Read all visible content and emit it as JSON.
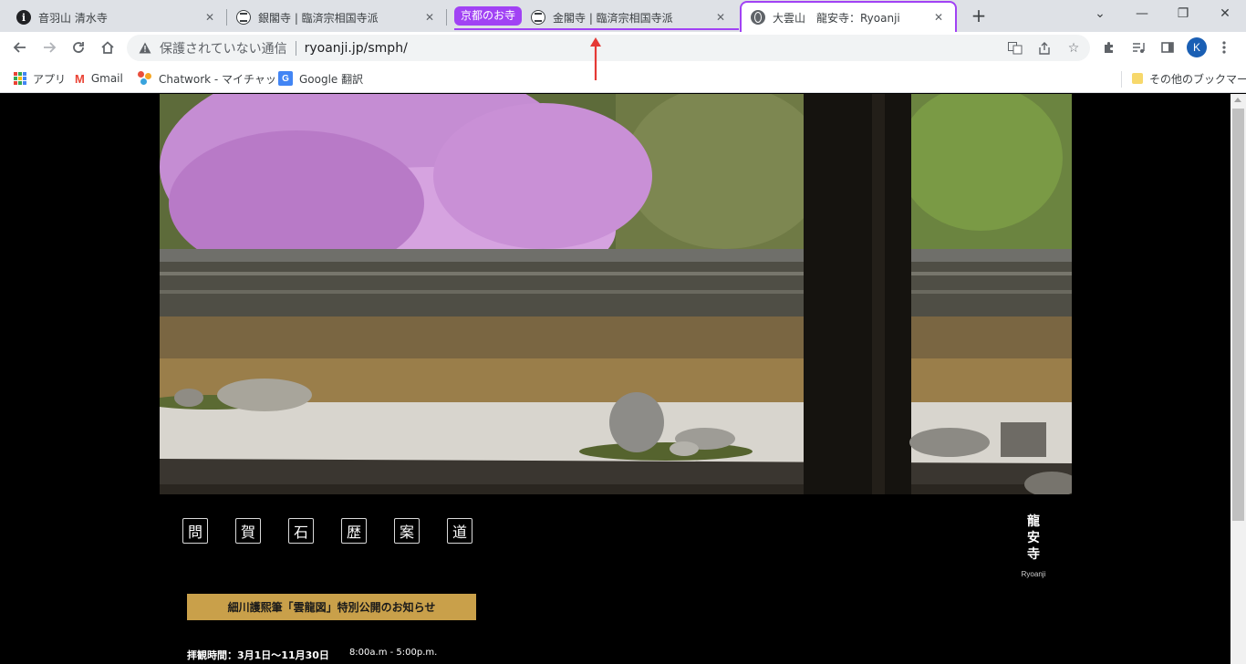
{
  "browser": {
    "tabs": [
      {
        "title": "音羽山 清水寺",
        "favicon": "info-icon"
      },
      {
        "title": "銀閣寺 | 臨済宗相国寺派",
        "favicon": "temple-icon"
      },
      {
        "title": "金閣寺 | 臨済宗相国寺派",
        "favicon": "temple-icon"
      },
      {
        "title": "大雲山　龍安寺：Ryoanji",
        "favicon": "globe-icon"
      }
    ],
    "active_tab_index": 3,
    "tab_group": {
      "label": "京都のお寺",
      "color": "#a142f4"
    },
    "new_tab_label": "+",
    "window_controls": {
      "minimize": "—",
      "restore": "❐",
      "close": "✕",
      "tab_list": "⌄"
    }
  },
  "toolbar": {
    "security_text": "保護されていない通信",
    "url": "ryoanji.jp/smph/",
    "profile_initial": "K"
  },
  "bookmarks": {
    "items": [
      {
        "label": "アプリ",
        "icon": "apps-grid-icon"
      },
      {
        "label": "Gmail",
        "icon": "gmail-icon"
      },
      {
        "label": "Chatwork - マイチャット",
        "icon": "chatwork-icon"
      },
      {
        "label": "Google 翻訳",
        "icon": "google-translate-icon"
      }
    ],
    "other_label": "その他のブックマーク"
  },
  "page": {
    "nav_buttons": [
      "問",
      "賀",
      "石",
      "歴",
      "案",
      "道"
    ],
    "logo_chars": [
      "龍",
      "安",
      "寺"
    ],
    "logo_roman": "Ryoanji",
    "notice_label": "細川護熙筆「雲龍図」特別公開のお知らせ",
    "hours_label": "拝観時間：3月1日〜11月30日",
    "hours_time": "8:00a.m - 5:00p.m."
  },
  "colors": {
    "accent": "#a142f4",
    "notice_bg": "#c9a04a",
    "annotation_arrow": "#e53935"
  }
}
